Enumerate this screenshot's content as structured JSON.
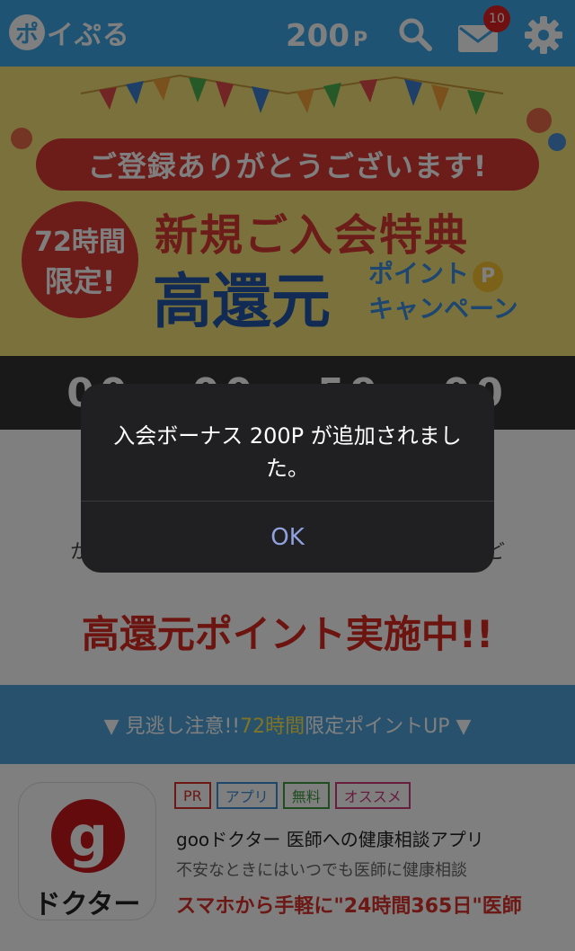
{
  "header": {
    "logo_bubble": "ポ",
    "logo_rest": "イぷる",
    "points_value": "200",
    "points_unit": "P",
    "mail_badge_count": "10",
    "accent": "#3fa7e6"
  },
  "banner": {
    "pill_text": "ご登録ありがとうございます!",
    "circle_line1": "72時間",
    "circle_line2": "限定!",
    "title": "新規ご入会特典",
    "big": "高還元",
    "campaign_line1": "ポイント",
    "campaign_line2": "キャンペーン",
    "campaign_symbol": "P"
  },
  "countdown": {
    "text": "00 : 00 : 59 : 00"
  },
  "section": {
    "sub_left": "か",
    "sub_right": "ど",
    "promo": "高還元ポイント実施中!!"
  },
  "bluebar": {
    "prefix": "▼ 見逃し注意!!",
    "highlight": "72時間",
    "suffix": "限定ポイントUP ▼"
  },
  "card": {
    "icon_letter": "g",
    "icon_caption": "ドクター",
    "tags": [
      "PR",
      "アプリ",
      "無料",
      "オススメ"
    ],
    "title": "gooドクター 医師への健康相談アプリ",
    "description": "不安なときにはいつでも医師に健康相談",
    "catch": "スマホから手軽に\"24時間365日\"医師"
  },
  "alert": {
    "message": "入会ボーナス 200P が追加されました。",
    "ok_label": "OK"
  }
}
